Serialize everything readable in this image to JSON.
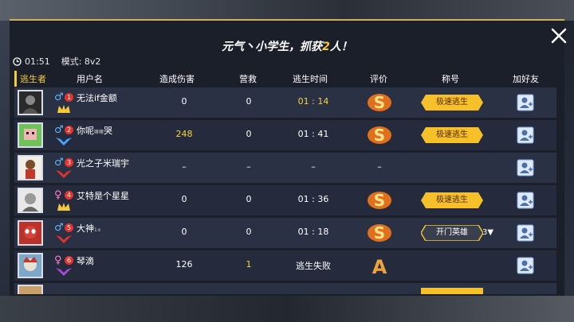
{
  "header": {
    "title_a": "元气丶小学生，抓获",
    "title_hl": "2",
    "title_b": "人！",
    "timer": "01:51",
    "mode": "模式: 8v2"
  },
  "columns": {
    "escaper": "逃生者",
    "username": "用户名",
    "damage": "造成伤害",
    "rescue": "营救",
    "escape_time": "逃生时间",
    "rating": "评价",
    "title": "称号",
    "add_friend": "加好友"
  },
  "rows": [
    {
      "rank": "1",
      "gender": "♂",
      "name": "无法if金额",
      "sup": "",
      "damage": "0",
      "rescue": "0",
      "time": "01 : 14",
      "grade": "S",
      "title": "极速逃生",
      "extra": ""
    },
    {
      "rank": "2",
      "gender": "♂",
      "name": "你呢",
      "sup": "嘛嘛",
      "name2": "哭",
      "damage": "248",
      "rescue": "0",
      "time": "01 : 41",
      "grade": "S",
      "title": "极速逃生",
      "extra": ""
    },
    {
      "rank": "3",
      "gender": "♂",
      "name": "光之子米瑞宇",
      "sup": "",
      "damage": "–",
      "rescue": "–",
      "time": "–",
      "grade": "–",
      "title": "",
      "extra": ""
    },
    {
      "rank": "4",
      "gender": "♀",
      "name": "艾特是个星星",
      "sup": "",
      "damage": "0",
      "rescue": "0",
      "time": "01 : 36",
      "grade": "S",
      "title": "极速逃生",
      "extra": ""
    },
    {
      "rank": "5",
      "gender": "♂",
      "name": "大神",
      "sup": "1±",
      "damage": "0",
      "rescue": "0",
      "time": "01 : 18",
      "grade": "S",
      "title": "开门英雄",
      "extra": "3▼"
    },
    {
      "rank": "6",
      "gender": "♀",
      "name": "琴滴",
      "sup": "",
      "damage": "126",
      "rescue": "1",
      "time": "逃生失败",
      "grade": "A",
      "title": "",
      "extra": ""
    }
  ],
  "colors": {
    "gold": "#f5d33a",
    "male": "#5fb6ff",
    "female": "#ff7fcf",
    "rank": "#e2342f"
  }
}
